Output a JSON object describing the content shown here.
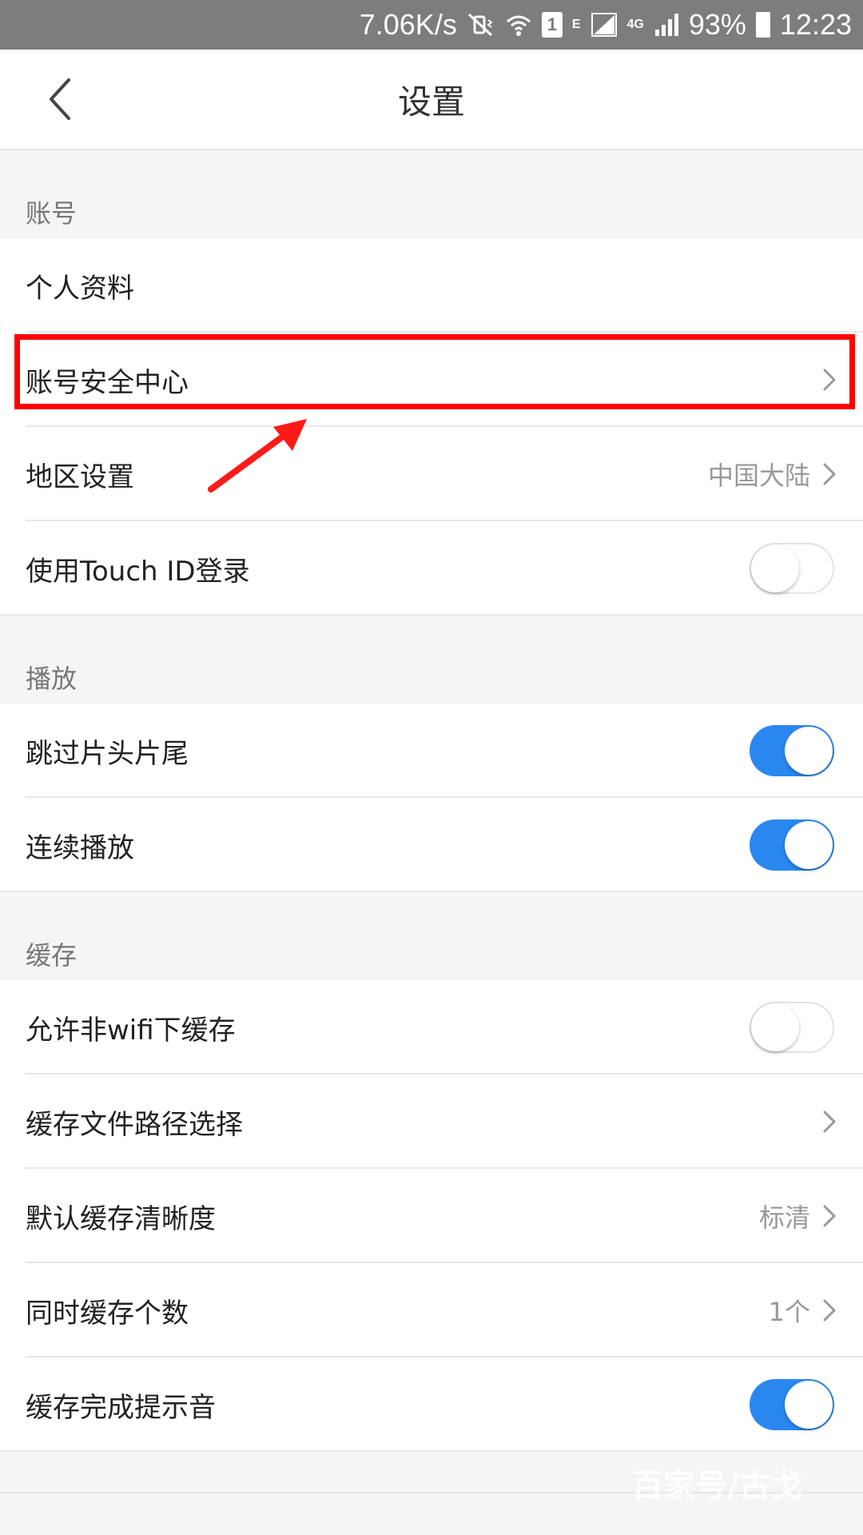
{
  "status_bar": {
    "network_speed": "7.06K/s",
    "sim_slot": "1",
    "net_type_e": "E",
    "net_type_4g": "4G",
    "battery": "93%",
    "time": "12:23",
    "icons": [
      "mute-vibrate-icon",
      "wifi-icon",
      "sim-icon",
      "signal-icon",
      "battery-icon"
    ]
  },
  "header": {
    "title": "设置",
    "back_icon": "chevron-left-icon"
  },
  "sections": {
    "account": {
      "title": "账号",
      "items": [
        {
          "label": "个人资料"
        },
        {
          "label": "账号安全中心"
        },
        {
          "label": "地区设置",
          "value": "中国大陆"
        },
        {
          "label": "使用Touch ID登录",
          "toggle": false
        }
      ]
    },
    "playback": {
      "title": "播放",
      "items": [
        {
          "label": "跳过片头片尾",
          "toggle": true
        },
        {
          "label": "连续播放",
          "toggle": true
        }
      ]
    },
    "cache": {
      "title": "缓存",
      "items": [
        {
          "label": "允许非wifi下缓存",
          "toggle": false
        },
        {
          "label": "缓存文件路径选择"
        },
        {
          "label": "默认缓存清晰度",
          "value": "标清"
        },
        {
          "label": "同时缓存个数",
          "value": "1个"
        },
        {
          "label": "缓存完成提示音",
          "toggle": true
        }
      ]
    }
  },
  "colors": {
    "toggle_on": "#2a87f0",
    "highlight": "#ff0000"
  },
  "watermark": "百家号/古戈"
}
